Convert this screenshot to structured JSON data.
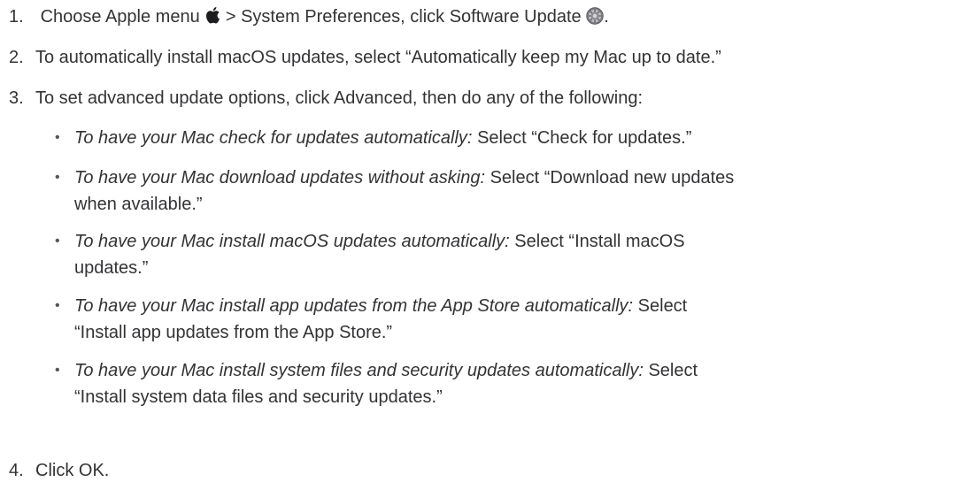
{
  "steps": [
    {
      "number": "1.",
      "text_a": "Choose Apple menu",
      "apple_icon": "apple-logo-icon",
      "text_b": "> System Preferences, click Software Update",
      "software_update_icon": "software-update-gear-icon",
      "text_c": "."
    },
    {
      "number": "2.",
      "text": "To automatically install macOS updates, select “Automatically keep my Mac up to date.”"
    },
    {
      "number": "3.",
      "text": "To set advanced update options, click Advanced, then do any of the following:"
    },
    {
      "number": "4.",
      "text": "Click OK."
    }
  ],
  "bullet_glyph": "•",
  "bullets": [
    {
      "italic": "To have your Mac check for updates automatically:",
      "line1": "Select “Check for updates.”"
    },
    {
      "italic": "To have your Mac download updates without asking:",
      "line1": "Select “Download new updates",
      "line2": "when available.”"
    },
    {
      "italic": "To have your Mac install macOS updates automatically:",
      "line1": "Select “Install macOS",
      "line2": "updates.”"
    },
    {
      "italic": "To have your Mac install app updates from the App Store automatically:",
      "line1": "Select",
      "line2": "“Install app updates from the App Store.”"
    },
    {
      "italic": "To have your Mac install system files and security updates automatically:",
      "line1": "Select",
      "line2": "“Install system data files and security updates.”"
    }
  ]
}
